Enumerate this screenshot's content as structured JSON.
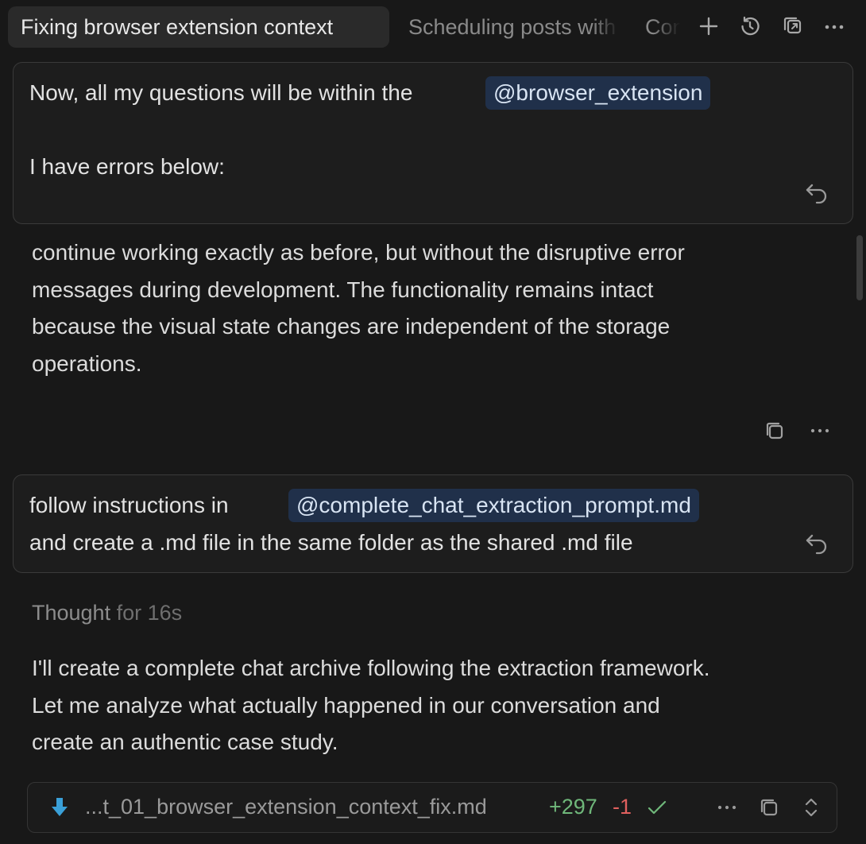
{
  "tabs": [
    {
      "label": "Fixing browser extension context"
    },
    {
      "label": "Scheduling posts with"
    },
    {
      "label": "Con"
    }
  ],
  "toolbar_icons": [
    "plus-icon",
    "history-icon",
    "open-external-icon",
    "more-icon"
  ],
  "messages": {
    "first_user": {
      "text_before": "Now, all my questions will be within the",
      "mention": "@browser_extension",
      "line2": "I have errors below:"
    },
    "assistant_paragraph": [
      "continue working exactly as before, but without the disruptive error",
      "messages during development. The functionality remains intact",
      "because the visual state changes are independent of the storage",
      "operations."
    ],
    "second_user": {
      "text_before": "follow instructions in",
      "mention": "@complete_chat_extraction_prompt.md",
      "line2": "and create a  .md file in the same folder as the shared .md file"
    },
    "thought": {
      "label": "Thought",
      "duration": "for 16s"
    },
    "assistant_reply": [
      "I'll create a complete chat archive following the extraction framework.",
      "Let me analyze what actually happened in our conversation and",
      "create an authentic case study."
    ],
    "file_change": {
      "filename": "...t_01_browser_extension_context_fix.md",
      "additions": "+297",
      "deletions": "-1"
    }
  },
  "colors": {
    "background": "#181818",
    "mention_bg": "#20304a",
    "additions": "#6fb77a",
    "deletions": "#e0605e",
    "file_icon": "#3aa0d8"
  }
}
